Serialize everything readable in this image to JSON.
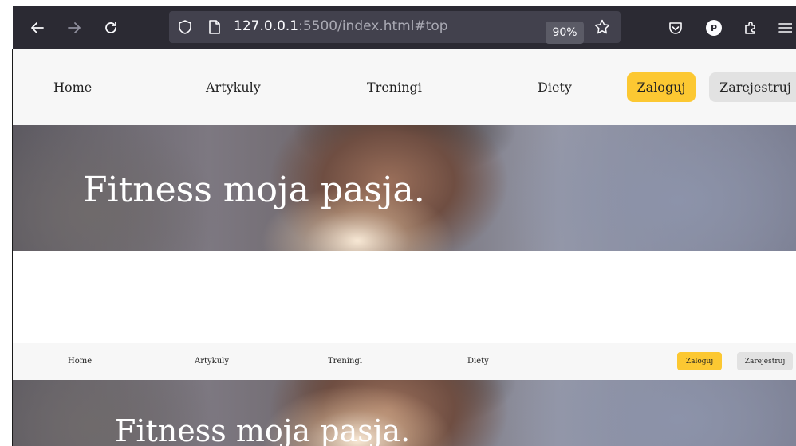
{
  "browser": {
    "url_host": "127.0.0.1",
    "url_rest": ":5500/index.html#top",
    "zoom": "90%",
    "profile_initial": "P",
    "icons": [
      "back-icon",
      "forward-icon",
      "reload-icon",
      "shield-icon",
      "page-icon",
      "star-icon",
      "pocket-icon",
      "profile-icon",
      "extensions-icon",
      "menu-icon"
    ]
  },
  "nav": {
    "home": "Home",
    "articles": "Artykuly",
    "trainings": "Treningi",
    "diets": "Diety",
    "login": "Zaloguj",
    "register": "Zarejestruj"
  },
  "hero": {
    "title": "Fitness moja pasja."
  },
  "colors": {
    "accent": "#fcc832",
    "nav_bg": "#f7f7f7",
    "chrome_bg": "#2b2a33"
  }
}
